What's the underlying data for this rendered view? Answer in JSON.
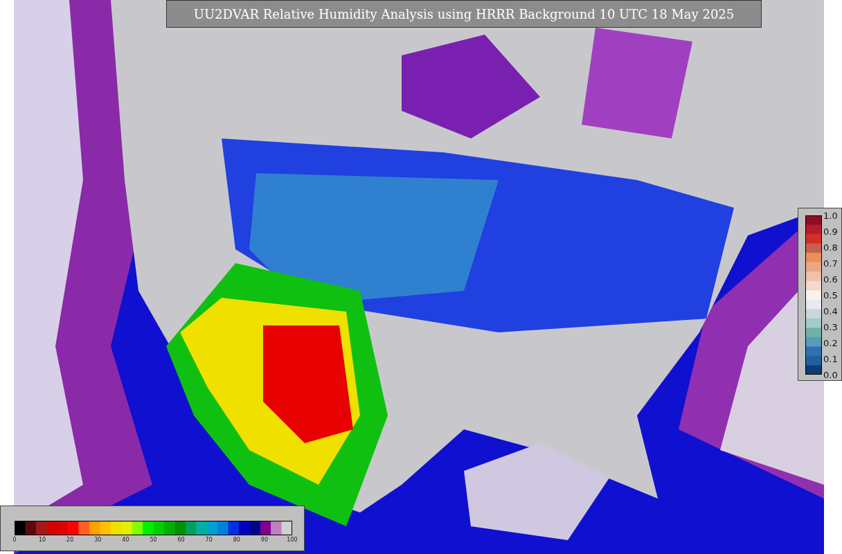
{
  "title": "UU2DVAR Relative Humidity Analysis using HRRR Background 10 UTC 18 May 2025",
  "humidity_colorbar": {
    "ticks": [
      "0",
      "10",
      "20",
      "30",
      "40",
      "50",
      "60",
      "70",
      "80",
      "90",
      "100"
    ]
  },
  "ratio_colorbar": {
    "ticks": [
      "1.0",
      "0.9",
      "0.8",
      "0.7",
      "0.6",
      "0.5",
      "0.4",
      "0.3",
      "0.2",
      "0.1",
      "0.0"
    ]
  }
}
